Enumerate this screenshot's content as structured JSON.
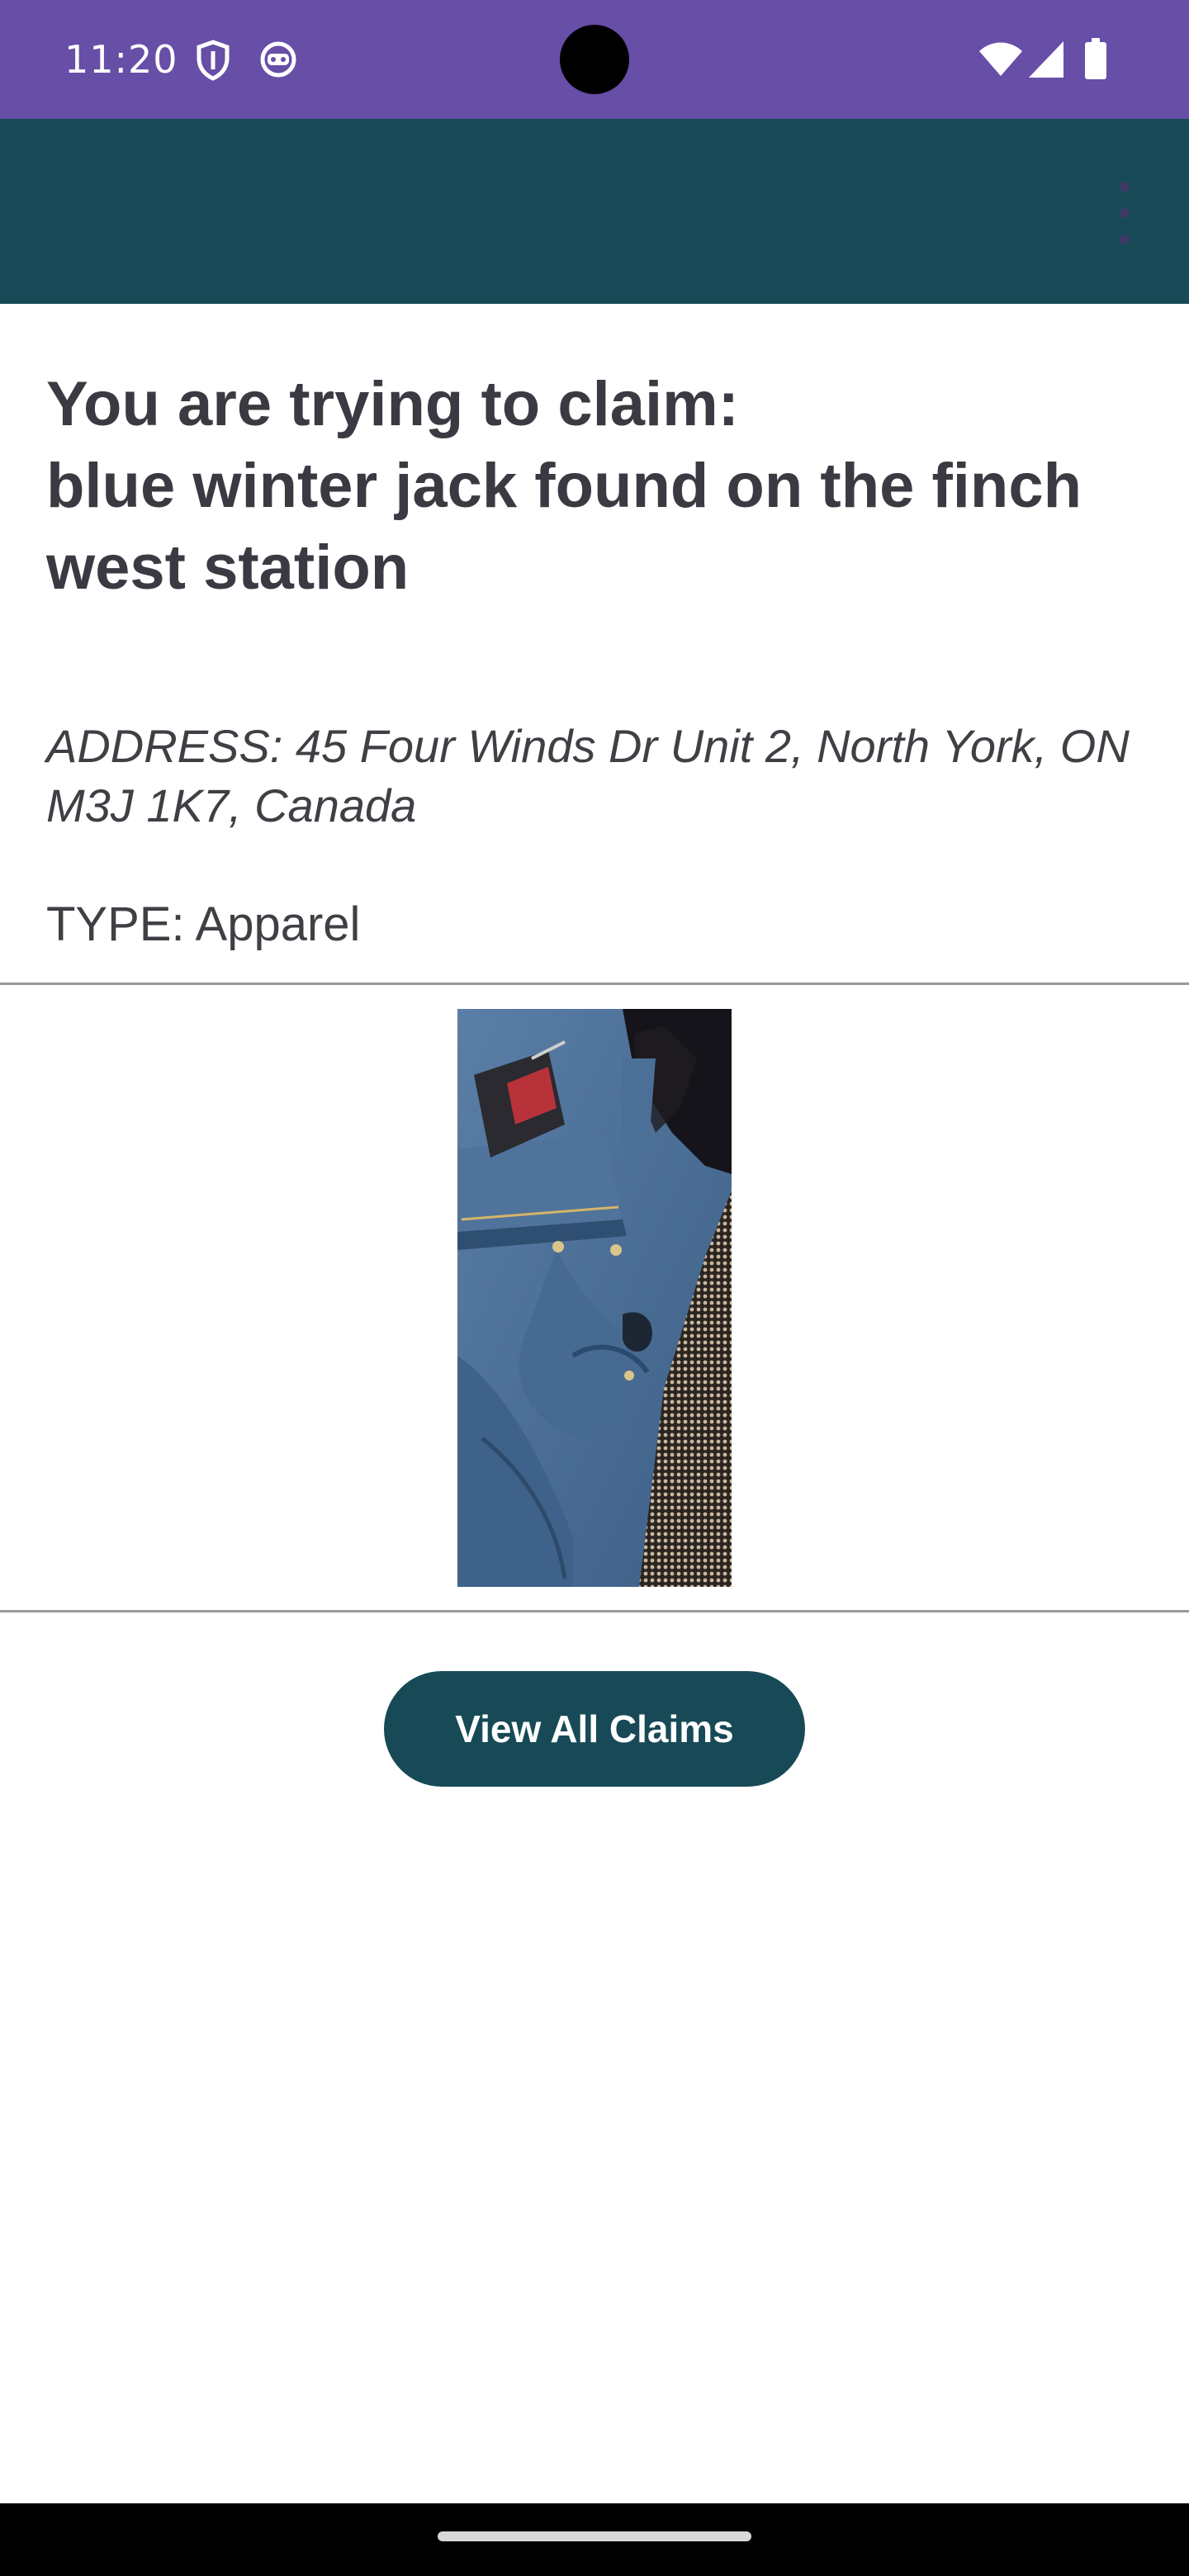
{
  "status_bar": {
    "time": "11:20",
    "left_icons": [
      "shield-icon",
      "android-robot-icon"
    ],
    "right_icons": [
      "wifi-icon",
      "cell-signal-icon",
      "battery-icon"
    ],
    "background_color": "#674ea7"
  },
  "app_bar": {
    "background_color": "#174a56",
    "overflow_icon": "more-vert-icon"
  },
  "claim": {
    "heading_line1": "You are trying to claim:",
    "heading_line2": "blue winter jack found on the finch west station",
    "address": "ADDRESS: 45 Four Winds Dr Unit 2, North York, ON M3J 1K7, Canada",
    "type": "TYPE: Apparel",
    "photo_subject": "blue winter jacket with fur-trimmed hood"
  },
  "actions": {
    "view_all_claims_label": "View All Claims",
    "button_color": "#174a56"
  }
}
